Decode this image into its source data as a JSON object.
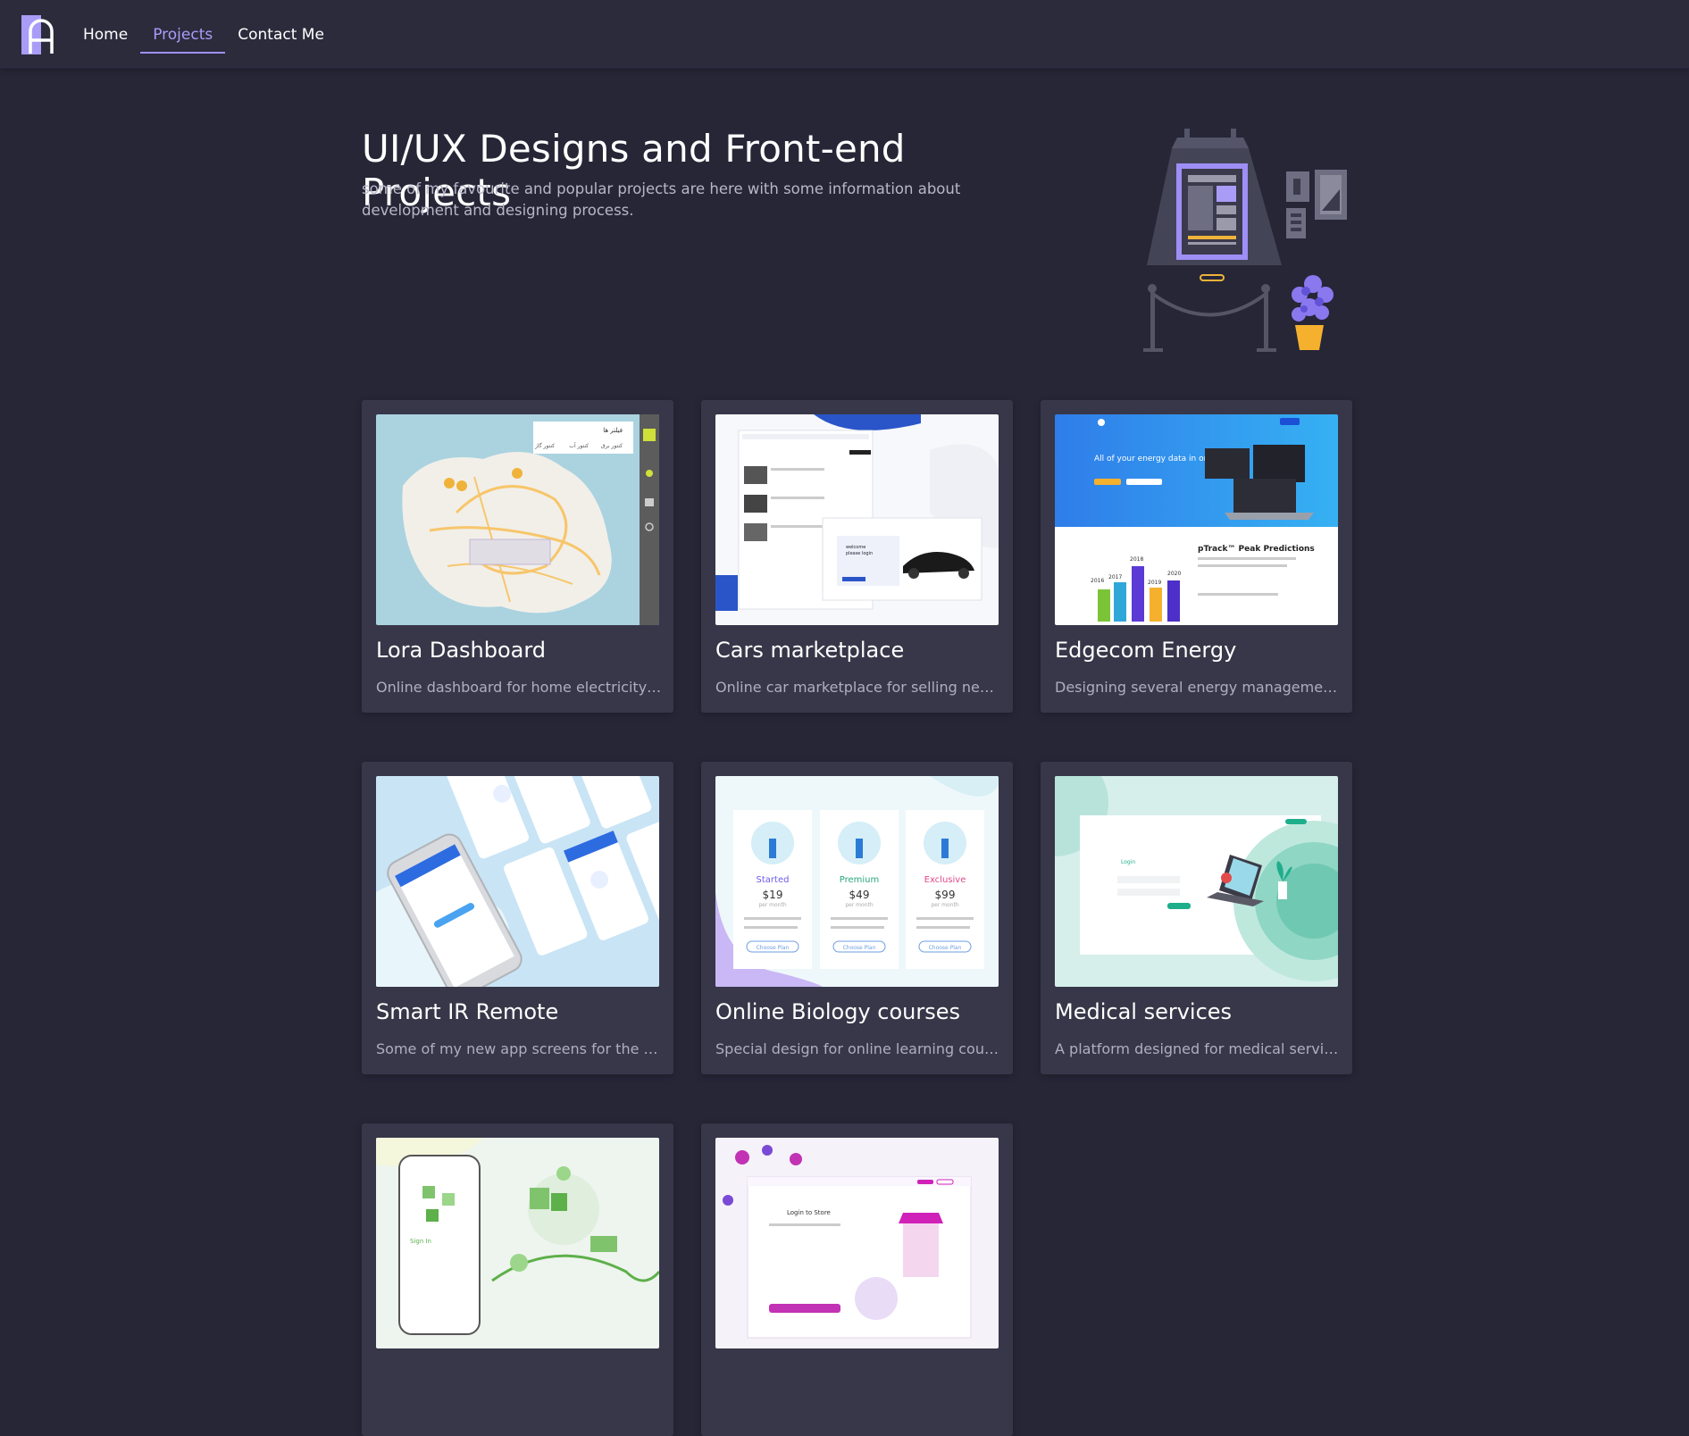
{
  "nav": {
    "items": [
      {
        "label": "Home",
        "active": false
      },
      {
        "label": "Projects",
        "active": true
      },
      {
        "label": "Contact Me",
        "active": false
      }
    ]
  },
  "hero": {
    "title": "UI/UX Designs and Front-end Projects",
    "subtitle": "some of my favourite and popular projects are here with some information about development and designing process."
  },
  "colors": {
    "background": "#262637",
    "topbar": "#2b2b3c",
    "card": "#373749",
    "accent": "#9d8ff5"
  },
  "projects": [
    {
      "title": "Lora Dashboard",
      "description": "Online dashboard for home electricity m...",
      "thumb_text": {
        "panel_title": "فیلتر ها",
        "opt1": "کنتور برق",
        "opt2": "کنتور آب",
        "opt3": "کنتور گاز"
      }
    },
    {
      "title": "Cars marketplace",
      "description": "Online car marketplace for selling new o...",
      "thumb_text": {
        "welcome": "welcome",
        "login": "please login"
      }
    },
    {
      "title": "Edgecom Energy",
      "description": "Designing several energy management d...",
      "thumb_text": {
        "headline": "All of your energy data in one place.",
        "peak": "pTrack™ Peak Predictions",
        "years": [
          "2016",
          "2017",
          "2018",
          "2019",
          "2020"
        ]
      }
    },
    {
      "title": "Smart IR Remote",
      "description": "Some of my new app screens for the Sm..."
    },
    {
      "title": "Online Biology courses",
      "description": "Special design for online learning course...",
      "thumb_text": {
        "plans": [
          {
            "name": "Started",
            "price": "$19"
          },
          {
            "name": "Premium",
            "price": "$49"
          },
          {
            "name": "Exclusive",
            "price": "$99"
          }
        ],
        "per": "per month",
        "choose": "Choose Plan"
      }
    },
    {
      "title": "Medical services",
      "description": "A platform designed for medical services...",
      "thumb_text": {
        "login": "Login"
      }
    },
    {
      "title": "",
      "description": "",
      "thumb_text": {
        "signin": "Sign In"
      }
    },
    {
      "title": "",
      "description": "",
      "thumb_text": {
        "login_store": "Login to Store"
      }
    }
  ]
}
